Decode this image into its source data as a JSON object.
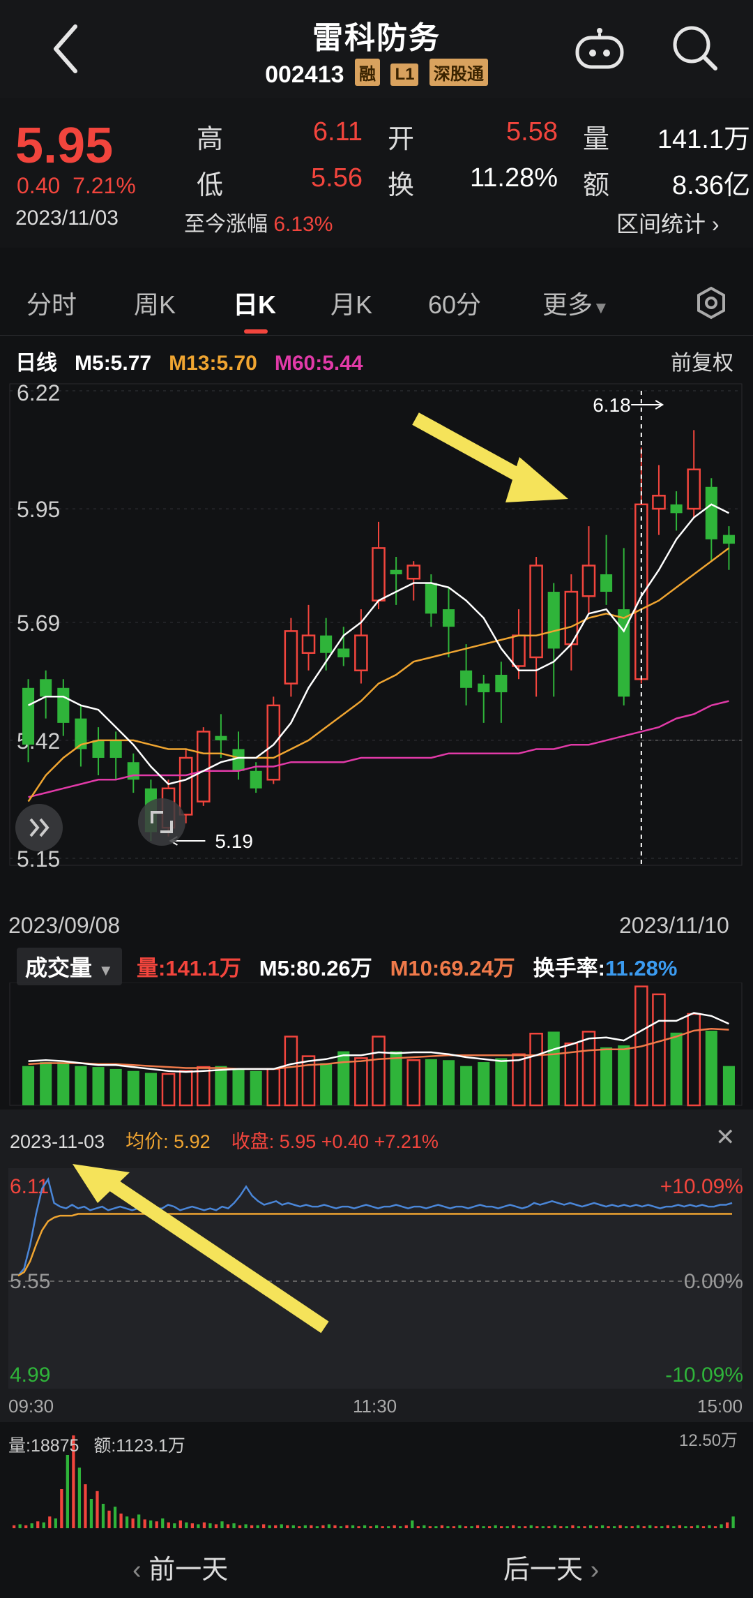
{
  "header": {
    "title": "雷科防务",
    "code": "002413",
    "tags": [
      "融",
      "L1",
      "深股通"
    ]
  },
  "quote": {
    "price": "5.95",
    "change": "0.40",
    "change_pct": "7.21%",
    "rows": [
      {
        "l1": "高",
        "v1": "6.11",
        "l2": "开",
        "v2": "5.58",
        "l3": "量",
        "v3": "141.1万"
      },
      {
        "l1": "低",
        "v1": "5.56",
        "l2": "换",
        "v2": "11.28%",
        "l3": "额",
        "v3": "8.36亿"
      }
    ],
    "date": "2023/11/03",
    "since_label": "至今涨幅",
    "since_value": "6.13%",
    "range_label": "区间统计"
  },
  "tabs": [
    "分时",
    "周K",
    "日K",
    "月K",
    "60分",
    "更多"
  ],
  "ma": {
    "label": "日线",
    "m5": "M5:5.77",
    "m13": "M13:5.70",
    "m60": "M60:5.44",
    "adjust": "前复权",
    "colors": {
      "m5": "#ffffff",
      "m13": "#f0a531",
      "m60": "#e23aa8"
    }
  },
  "chart_data": [
    {
      "type": "candlestick",
      "title": "",
      "y_ticks": [
        "6.22",
        "5.95",
        "5.69",
        "5.42",
        "5.15"
      ],
      "ylim": [
        5.15,
        6.22
      ],
      "x_labels": [
        "2023/09/08",
        "2023/11/10"
      ],
      "high_marker": "6.18",
      "low_marker": "5.19",
      "candles": [
        {
          "o": 5.54,
          "c": 5.41,
          "h": 5.56,
          "l": 5.37
        },
        {
          "o": 5.56,
          "c": 5.52,
          "h": 5.58,
          "l": 5.47
        },
        {
          "o": 5.54,
          "c": 5.46,
          "h": 5.56,
          "l": 5.43
        },
        {
          "o": 5.47,
          "c": 5.4,
          "h": 5.5,
          "l": 5.36
        },
        {
          "o": 5.42,
          "c": 5.38,
          "h": 5.45,
          "l": 5.34
        },
        {
          "o": 5.42,
          "c": 5.38,
          "h": 5.44,
          "l": 5.33
        },
        {
          "o": 5.37,
          "c": 5.33,
          "h": 5.39,
          "l": 5.3
        },
        {
          "o": 5.31,
          "c": 5.21,
          "h": 5.33,
          "l": 5.19
        },
        {
          "o": 5.22,
          "c": 5.31,
          "h": 5.33,
          "l": 5.2
        },
        {
          "o": 5.25,
          "c": 5.38,
          "h": 5.4,
          "l": 5.23
        },
        {
          "o": 5.28,
          "c": 5.44,
          "h": 5.45,
          "l": 5.27
        },
        {
          "o": 5.43,
          "c": 5.42,
          "h": 5.48,
          "l": 5.38
        },
        {
          "o": 5.4,
          "c": 5.35,
          "h": 5.44,
          "l": 5.33
        },
        {
          "o": 5.35,
          "c": 5.31,
          "h": 5.37,
          "l": 5.3
        },
        {
          "o": 5.33,
          "c": 5.5,
          "h": 5.52,
          "l": 5.32
        },
        {
          "o": 5.55,
          "c": 5.67,
          "h": 5.7,
          "l": 5.52
        },
        {
          "o": 5.62,
          "c": 5.66,
          "h": 5.73,
          "l": 5.58
        },
        {
          "o": 5.66,
          "c": 5.62,
          "h": 5.7,
          "l": 5.58
        },
        {
          "o": 5.63,
          "c": 5.61,
          "h": 5.68,
          "l": 5.59
        },
        {
          "o": 5.58,
          "c": 5.66,
          "h": 5.72,
          "l": 5.55
        },
        {
          "o": 5.74,
          "c": 5.86,
          "h": 5.92,
          "l": 5.72
        },
        {
          "o": 5.81,
          "c": 5.8,
          "h": 5.84,
          "l": 5.73
        },
        {
          "o": 5.79,
          "c": 5.82,
          "h": 5.83,
          "l": 5.74
        },
        {
          "o": 5.78,
          "c": 5.71,
          "h": 5.8,
          "l": 5.68
        },
        {
          "o": 5.72,
          "c": 5.68,
          "h": 5.77,
          "l": 5.61
        },
        {
          "o": 5.58,
          "c": 5.54,
          "h": 5.64,
          "l": 5.5
        },
        {
          "o": 5.55,
          "c": 5.53,
          "h": 5.57,
          "l": 5.46
        },
        {
          "o": 5.57,
          "c": 5.53,
          "h": 5.6,
          "l": 5.46
        },
        {
          "o": 5.59,
          "c": 5.66,
          "h": 5.72,
          "l": 5.56
        },
        {
          "o": 5.61,
          "c": 5.82,
          "h": 5.84,
          "l": 5.52
        },
        {
          "o": 5.76,
          "c": 5.63,
          "h": 5.78,
          "l": 5.52
        },
        {
          "o": 5.64,
          "c": 5.76,
          "h": 5.8,
          "l": 5.58
        },
        {
          "o": 5.75,
          "c": 5.82,
          "h": 5.91,
          "l": 5.71
        },
        {
          "o": 5.8,
          "c": 5.76,
          "h": 5.89,
          "l": 5.73
        },
        {
          "o": 5.72,
          "c": 5.52,
          "h": 5.86,
          "l": 5.5
        },
        {
          "o": 5.56,
          "c": 5.96,
          "h": 6.09,
          "l": 5.55
        },
        {
          "o": 5.95,
          "c": 5.98,
          "h": 6.05,
          "l": 5.89
        },
        {
          "o": 5.96,
          "c": 5.94,
          "h": 5.99,
          "l": 5.9
        },
        {
          "o": 5.95,
          "c": 6.04,
          "h": 6.13,
          "l": 5.93
        },
        {
          "o": 6.0,
          "c": 5.88,
          "h": 6.02,
          "l": 5.83
        },
        {
          "o": 5.89,
          "c": 5.87,
          "h": 5.91,
          "l": 5.81
        }
      ],
      "ma5": [
        5.5,
        5.52,
        5.52,
        5.5,
        5.49,
        5.45,
        5.41,
        5.36,
        5.32,
        5.33,
        5.35,
        5.37,
        5.38,
        5.38,
        5.41,
        5.46,
        5.54,
        5.6,
        5.66,
        5.69,
        5.74,
        5.76,
        5.78,
        5.78,
        5.77,
        5.74,
        5.7,
        5.63,
        5.58,
        5.58,
        5.6,
        5.64,
        5.71,
        5.72,
        5.67,
        5.75,
        5.81,
        5.88,
        5.93,
        5.96,
        5.94
      ],
      "ma13": [
        5.28,
        5.34,
        5.38,
        5.41,
        5.42,
        5.42,
        5.42,
        5.41,
        5.4,
        5.4,
        5.39,
        5.39,
        5.38,
        5.38,
        5.38,
        5.4,
        5.42,
        5.45,
        5.48,
        5.51,
        5.55,
        5.57,
        5.6,
        5.61,
        5.62,
        5.63,
        5.64,
        5.65,
        5.66,
        5.66,
        5.67,
        5.68,
        5.7,
        5.71,
        5.7,
        5.72,
        5.74,
        5.77,
        5.8,
        5.83,
        5.86
      ],
      "ma60": [
        5.29,
        5.3,
        5.31,
        5.32,
        5.33,
        5.33,
        5.34,
        5.34,
        5.34,
        5.34,
        5.35,
        5.35,
        5.35,
        5.36,
        5.36,
        5.37,
        5.37,
        5.37,
        5.37,
        5.38,
        5.38,
        5.38,
        5.38,
        5.38,
        5.39,
        5.39,
        5.39,
        5.39,
        5.39,
        5.4,
        5.4,
        5.41,
        5.41,
        5.42,
        5.43,
        5.44,
        5.45,
        5.47,
        5.48,
        5.5,
        5.51
      ]
    },
    {
      "type": "bar",
      "title": "",
      "values": [
        40,
        44,
        44,
        40,
        39,
        37,
        35,
        33,
        32,
        35,
        39,
        40,
        37,
        35,
        37,
        70,
        50,
        43,
        55,
        48,
        70,
        55,
        46,
        47,
        46,
        40,
        44,
        48,
        52,
        73,
        75,
        63,
        75,
        59,
        61,
        121,
        113,
        74,
        93,
        76,
        40
      ],
      "ylim": [
        0,
        125
      ],
      "ma5_values": [
        45,
        46,
        45,
        43,
        41,
        41,
        39,
        37,
        35,
        34,
        35,
        36,
        37,
        37,
        37,
        42,
        45,
        47,
        51,
        51,
        54,
        53,
        54,
        54,
        52,
        49,
        47,
        45,
        46,
        51,
        57,
        62,
        68,
        69,
        66,
        76,
        86,
        86,
        94,
        91,
        83
      ],
      "ma10_values": [
        42,
        43,
        43,
        43,
        42,
        42,
        41,
        40,
        39,
        38,
        38,
        38,
        37,
        37,
        37,
        39,
        41,
        42,
        44,
        45,
        47,
        48,
        49,
        50,
        51,
        51,
        51,
        51,
        51,
        51,
        52,
        54,
        56,
        57,
        57,
        60,
        65,
        70,
        76,
        78,
        77
      ]
    },
    {
      "type": "line",
      "title": "",
      "y_ticks_left": [
        "6.11",
        "5.55",
        "4.99"
      ],
      "y_ticks_right": [
        "+10.09%",
        "0.00%",
        "-10.09%"
      ],
      "x_labels": [
        "09:30",
        "11:30",
        "15:00"
      ],
      "ylim": [
        4.99,
        6.11
      ],
      "price": [
        5.58,
        5.62,
        5.75,
        5.92,
        6.06,
        6.11,
        5.98,
        5.96,
        5.95,
        5.97,
        5.95,
        5.96,
        5.94,
        5.95,
        5.96,
        5.94,
        5.95,
        5.96,
        5.95,
        5.94,
        5.95,
        5.96,
        5.94,
        5.95,
        5.95,
        5.97,
        5.96,
        5.94,
        5.95,
        5.96,
        5.95,
        5.94,
        5.95,
        5.94,
        5.96,
        5.95,
        5.98,
        6.02,
        6.07,
        6.02,
        5.99,
        5.97,
        5.98,
        5.99,
        5.97,
        5.98,
        5.97,
        5.96,
        5.97,
        5.96,
        5.96,
        5.97,
        5.96,
        5.95,
        5.96,
        5.96,
        5.95,
        5.96,
        5.97,
        5.96,
        5.95,
        5.96,
        5.96,
        5.97,
        5.96,
        5.95,
        5.96,
        5.96,
        5.95,
        5.96,
        5.97,
        5.96,
        5.95,
        5.96,
        5.96,
        5.95,
        5.96,
        5.97,
        5.96,
        5.96,
        5.95,
        5.96,
        5.97,
        5.96,
        5.95,
        5.96,
        5.98,
        5.97,
        5.98,
        5.99,
        5.98,
        5.97,
        5.98,
        5.97,
        5.96,
        5.97,
        5.98,
        5.97,
        5.96,
        5.97,
        5.96,
        5.97,
        5.96,
        5.97,
        5.96,
        5.97,
        5.96,
        5.95,
        5.96,
        5.96,
        5.97,
        5.96,
        5.97,
        5.96,
        5.97,
        5.96,
        5.96,
        5.97,
        5.97,
        5.98
      ],
      "avg": [
        5.58,
        5.6,
        5.66,
        5.75,
        5.83,
        5.88,
        5.9,
        5.91,
        5.91,
        5.91,
        5.92,
        5.92,
        5.92,
        5.92,
        5.92,
        5.92,
        5.92,
        5.92,
        5.92,
        5.92,
        5.92,
        5.92,
        5.92,
        5.92,
        5.92,
        5.92,
        5.92,
        5.92,
        5.92,
        5.92,
        5.92,
        5.92,
        5.92,
        5.92,
        5.92,
        5.92,
        5.92,
        5.92,
        5.92,
        5.92,
        5.92,
        5.92,
        5.92,
        5.92,
        5.92,
        5.92,
        5.92,
        5.92,
        5.92,
        5.92,
        5.92,
        5.92,
        5.92,
        5.92,
        5.92,
        5.92,
        5.92,
        5.92,
        5.92,
        5.92,
        5.92,
        5.92,
        5.92,
        5.92,
        5.92,
        5.92,
        5.92,
        5.92,
        5.92,
        5.92,
        5.92,
        5.92,
        5.92,
        5.92,
        5.92,
        5.92,
        5.92,
        5.92,
        5.92,
        5.92,
        5.92,
        5.92,
        5.92,
        5.92,
        5.92,
        5.92,
        5.92,
        5.92,
        5.92,
        5.92,
        5.92,
        5.92,
        5.92,
        5.92,
        5.92,
        5.92,
        5.92,
        5.92,
        5.92,
        5.92,
        5.92,
        5.92,
        5.92,
        5.92,
        5.92,
        5.92,
        5.92,
        5.92,
        5.92,
        5.92,
        5.92,
        5.92,
        5.92,
        5.92,
        5.92,
        5.92,
        5.92,
        5.92,
        5.92,
        5.92
      ]
    },
    {
      "type": "bar",
      "title": "",
      "max_label": "12.50万",
      "values": [
        3,
        4,
        3,
        5,
        7,
        6,
        12,
        10,
        40,
        75,
        95,
        62,
        45,
        30,
        38,
        25,
        18,
        22,
        15,
        12,
        10,
        14,
        9,
        8,
        7,
        10,
        6,
        5,
        8,
        6,
        5,
        4,
        6,
        5,
        4,
        7,
        4,
        5,
        3,
        4,
        3,
        3,
        4,
        3,
        3,
        4,
        3,
        3,
        2,
        3,
        3,
        2,
        3,
        4,
        3,
        2,
        3,
        3,
        2,
        3,
        2,
        3,
        2,
        2,
        3,
        2,
        3,
        8,
        2,
        3,
        2,
        2,
        3,
        2,
        2,
        3,
        2,
        2,
        3,
        2,
        2,
        3,
        2,
        2,
        3,
        2,
        2,
        3,
        2,
        2,
        2,
        3,
        2,
        2,
        3,
        2,
        2,
        3,
        2,
        3,
        2,
        2,
        3,
        2,
        2,
        3,
        2,
        3,
        2,
        2,
        3,
        2,
        3,
        2,
        2,
        3,
        2,
        3,
        2,
        4,
        6,
        12
      ],
      "colors": [
        "red",
        "green"
      ]
    }
  ],
  "annotations": {
    "start_label": "2023/09/08",
    "end_label": "2023/11/10"
  },
  "volume": {
    "button": "成交量",
    "vol_label": "量:141.1万",
    "m5": "M5:80.26万",
    "m10": "M10:69.24万",
    "turnover_label": "换手率:",
    "turnover_value": "11.28%"
  },
  "intraday": {
    "date": "2023-11-03",
    "avg_label": "均价: 5.92",
    "close_label": "收盘: 5.95 +0.40 +7.21%",
    "vol_label": "量:18875",
    "amount_label": "额:1123.1万"
  },
  "nav": {
    "prev": "前一天",
    "next": "后一天"
  }
}
